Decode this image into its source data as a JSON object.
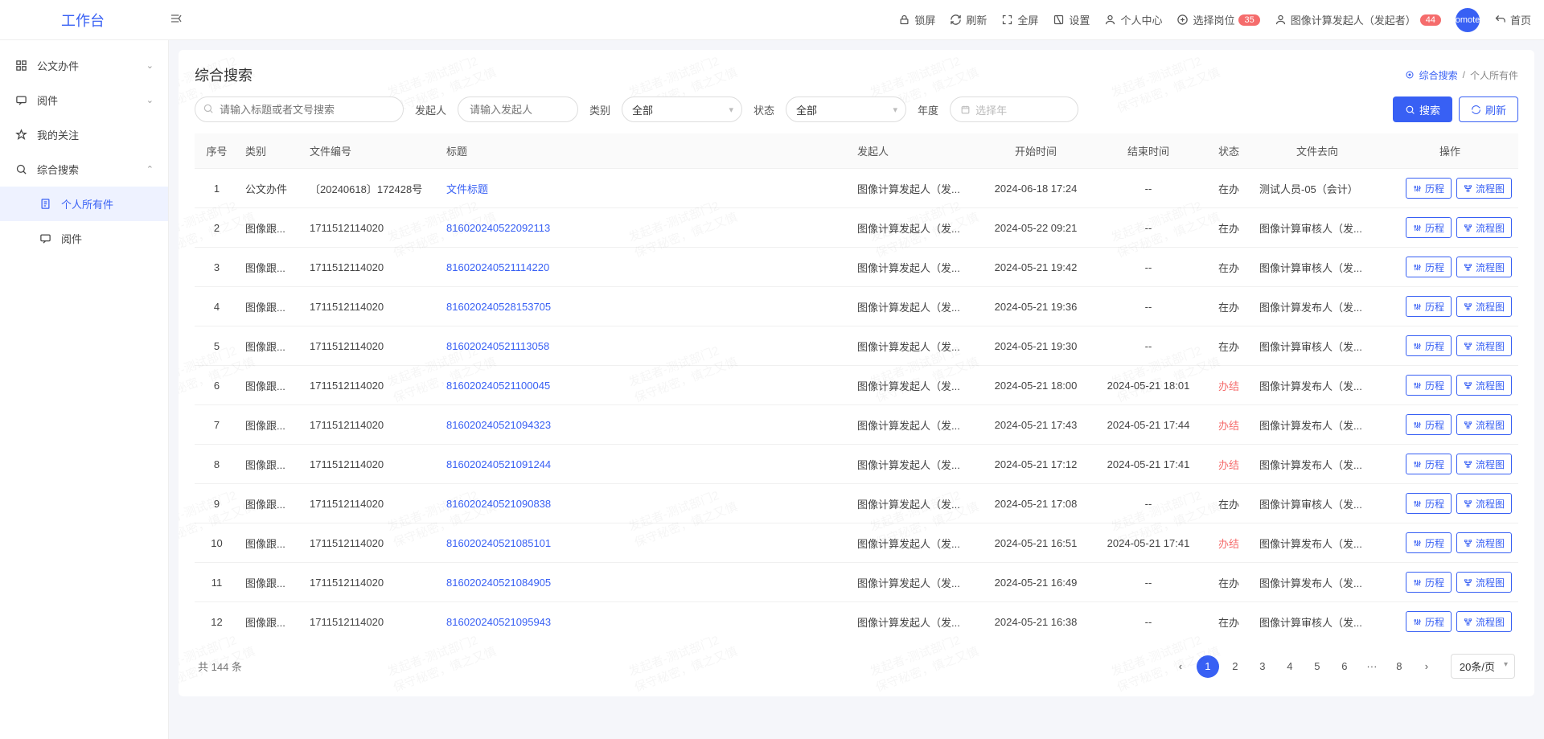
{
  "app": {
    "logo": "工作台",
    "avatar_text": "omote"
  },
  "header": {
    "lock": "锁屏",
    "refresh": "刷新",
    "fullscreen": "全屏",
    "settings": "设置",
    "usercenter": "个人中心",
    "selectpost": "选择岗位",
    "selectpost_badge": "35",
    "role": "图像计算发起人（发起者）",
    "role_badge": "44",
    "home": "首页"
  },
  "sidebar": [
    {
      "label": "公文办件",
      "icon": "grid",
      "expand": true,
      "interact": true
    },
    {
      "label": "阅件",
      "icon": "chat",
      "expand": true,
      "interact": true
    },
    {
      "label": "我的关注",
      "icon": "star",
      "interact": true
    },
    {
      "label": "综合搜索",
      "icon": "search",
      "expand": true,
      "expanded": true,
      "interact": true
    },
    {
      "label": "个人所有件",
      "icon": "doc",
      "sub": true,
      "active": true,
      "interact": true
    },
    {
      "label": "阅件",
      "icon": "chat",
      "sub": true,
      "interact": true
    }
  ],
  "page": {
    "title": "综合搜索",
    "breadcrumb": {
      "root": "综合搜索",
      "leaf": "个人所有件"
    },
    "filters": {
      "search_placeholder": "请输入标题或者文号搜索",
      "starter_label": "发起人",
      "starter_placeholder": "请输入发起人",
      "type_label": "类别",
      "type_value": "全部",
      "status_label": "状态",
      "status_value": "全部",
      "year_label": "年度",
      "year_placeholder": "选择年",
      "search_btn": "搜索",
      "refresh_btn": "刷新"
    }
  },
  "columns": [
    "序号",
    "类别",
    "文件编号",
    "标题",
    "发起人",
    "开始时间",
    "结束时间",
    "状态",
    "文件去向",
    "操作"
  ],
  "ops": {
    "history": "历程",
    "flow": "流程图"
  },
  "rows": [
    {
      "idx": 1,
      "type": "公文办件",
      "docnum": "〔20240618〕172428号",
      "title": "文件标题",
      "starter": "图像计算发起人（发...",
      "start": "2024-06-18 17:24",
      "end": "--",
      "status": "在办",
      "dest": "测试人员-05（会计）"
    },
    {
      "idx": 2,
      "type": "图像跟...",
      "docnum": "1711512114020",
      "title": "81602024052209​2113",
      "starter": "图像计算发起人（发...",
      "start": "2024-05-22 09:21",
      "end": "--",
      "status": "在办",
      "dest": "图像计算审核人（发..."
    },
    {
      "idx": 3,
      "type": "图像跟...",
      "docnum": "1711512114020",
      "title": "8160202405211​14220",
      "starter": "图像计算发起人（发...",
      "start": "2024-05-21 19:42",
      "end": "--",
      "status": "在办",
      "dest": "图像计算审核人（发..."
    },
    {
      "idx": 4,
      "type": "图像跟...",
      "docnum": "1711512114020",
      "title": "8160202405281​53705",
      "starter": "图像计算发起人（发...",
      "start": "2024-05-21 19:36",
      "end": "--",
      "status": "在办",
      "dest": "图像计算发布人（发..."
    },
    {
      "idx": 5,
      "type": "图像跟...",
      "docnum": "1711512114020",
      "title": "8160202405211​13058",
      "starter": "图像计算发起人（发...",
      "start": "2024-05-21 19:30",
      "end": "--",
      "status": "在办",
      "dest": "图像计算审核人（发..."
    },
    {
      "idx": 6,
      "type": "图像跟...",
      "docnum": "1711512114020",
      "title": "8160202405211​00045",
      "starter": "图像计算发起人（发...",
      "start": "2024-05-21 18:00",
      "end": "2024-05-21 18:01",
      "status": "办结",
      "status_done": true,
      "dest": "图像计算发布人（发..."
    },
    {
      "idx": 7,
      "type": "图像跟...",
      "docnum": "1711512114020",
      "title": "8160202405210​94323",
      "starter": "图像计算发起人（发...",
      "start": "2024-05-21 17:43",
      "end": "2024-05-21 17:44",
      "status": "办结",
      "status_done": true,
      "dest": "图像计算发布人（发..."
    },
    {
      "idx": 8,
      "type": "图像跟...",
      "docnum": "1711512114020",
      "title": "8160202405210​91244",
      "starter": "图像计算发起人（发...",
      "start": "2024-05-21 17:12",
      "end": "2024-05-21 17:41",
      "status": "办结",
      "status_done": true,
      "dest": "图像计算发布人（发..."
    },
    {
      "idx": 9,
      "type": "图像跟...",
      "docnum": "1711512114020",
      "title": "8160202405210​90838",
      "starter": "图像计算发起人（发...",
      "start": "2024-05-21 17:08",
      "end": "--",
      "status": "在办",
      "dest": "图像计算审核人（发..."
    },
    {
      "idx": 10,
      "type": "图像跟...",
      "docnum": "1711512114020",
      "title": "8160202405210​85101",
      "starter": "图像计算发起人（发...",
      "start": "2024-05-21 16:51",
      "end": "2024-05-21 17:41",
      "status": "办结",
      "status_done": true,
      "dest": "图像计算发布人（发..."
    },
    {
      "idx": 11,
      "type": "图像跟...",
      "docnum": "1711512114020",
      "title": "8160202405210​84905",
      "starter": "图像计算发起人（发...",
      "start": "2024-05-21 16:49",
      "end": "--",
      "status": "在办",
      "dest": "图像计算发布人（发..."
    },
    {
      "idx": 12,
      "type": "图像跟...",
      "docnum": "1711512114020",
      "title": "8160202405210​95943",
      "starter": "图像计算发起人（发...",
      "start": "2024-05-21 16:38",
      "end": "--",
      "status": "在办",
      "dest": "图像计算审核人（发..."
    }
  ],
  "footer": {
    "total": "共 144 条",
    "pages": [
      "1",
      "2",
      "3",
      "4",
      "5",
      "6",
      "···",
      "8"
    ],
    "pagesize": "20条/页"
  },
  "watermark": "发起者-测试部门2\n保守秘密，慎之又慎"
}
